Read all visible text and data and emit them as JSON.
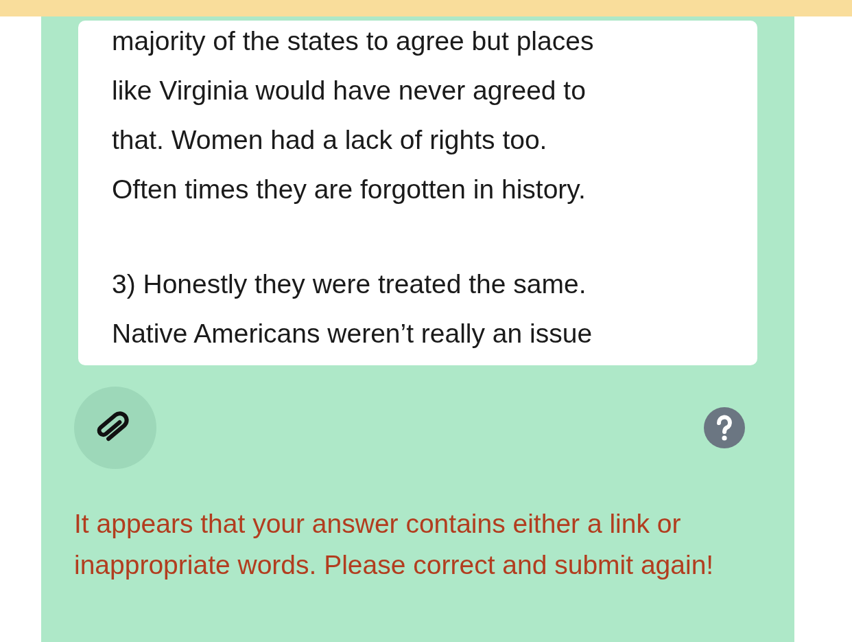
{
  "answer": {
    "paragraphs": [
      [
        "majority of the states to agree but places",
        "like Virginia would have never agreed to",
        "that. Women had a lack of rights too.",
        "Often times they are forgotten in history."
      ],
      [
        "3) Honestly they were treated the same.",
        "Native Americans weren’t really an issue"
      ]
    ]
  },
  "error_message": "It appears that your answer contains either a link or inappropriate words. Please correct and submit again!"
}
